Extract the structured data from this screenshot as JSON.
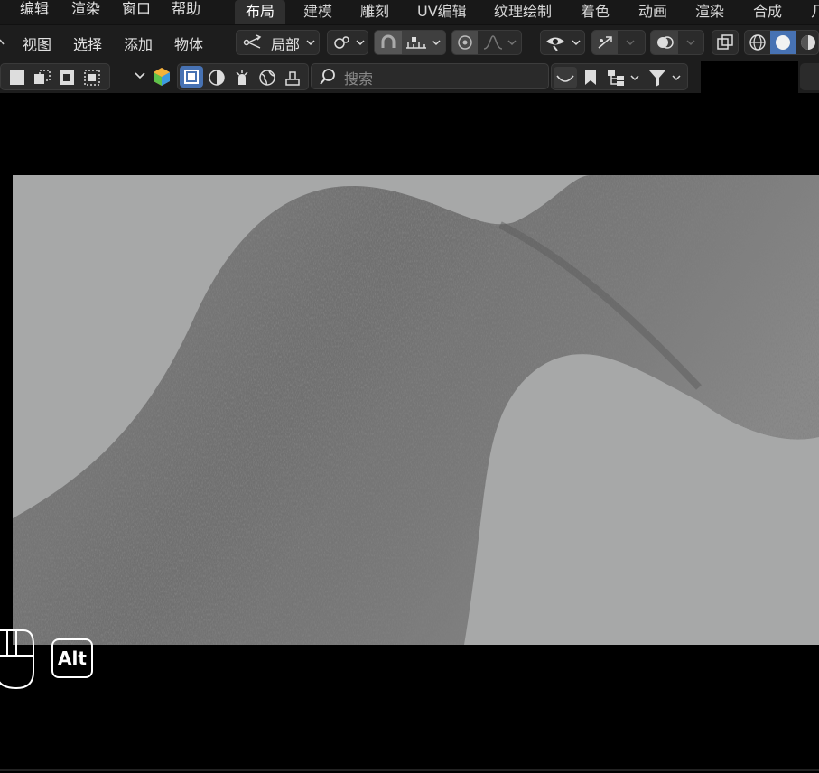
{
  "menubar": {
    "items": [
      "编辑",
      "渲染",
      "窗口",
      "帮助"
    ],
    "workspace_tabs": [
      "布局",
      "建模",
      "雕刻",
      "UV编辑",
      "纹理绘制",
      "着色",
      "动画",
      "渲染",
      "合成",
      "几"
    ],
    "active_tab": "布局"
  },
  "toolbar1": {
    "view": "视图",
    "select": "选择",
    "add": "添加",
    "object": "物体",
    "transform_orientation": "局部"
  },
  "toolbar2": {
    "search_placeholder": "搜索"
  },
  "overlay": {
    "key_label": "Alt"
  },
  "colors": {
    "accent": "#4772b3",
    "bg_dark": "#1d1d1d",
    "render_bg": "#a7a8a8"
  }
}
